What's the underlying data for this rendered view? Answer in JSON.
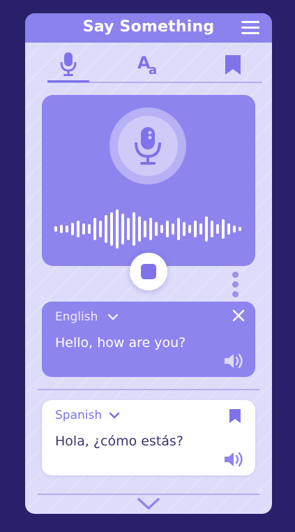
{
  "header": {
    "title": "Say Something",
    "menu_icon": "hamburger-menu-icon"
  },
  "tabs": [
    {
      "icon": "microphone-icon",
      "active": true
    },
    {
      "icon": "text-size-icon",
      "active": false
    },
    {
      "icon": "bookmark-icon",
      "active": false
    }
  ],
  "recorder": {
    "mic_icon": "microphone-icon",
    "state": "recording",
    "stop_icon": "stop-icon"
  },
  "source": {
    "language": "English",
    "text": "Hello, how are you?"
  },
  "target": {
    "language": "Spanish",
    "text": "Hola, ¿cómo estás?"
  },
  "colors": {
    "accent": "#8e84ee",
    "background": "#2a1f6b",
    "panel": "#ddddfb",
    "white": "#ffffff"
  }
}
